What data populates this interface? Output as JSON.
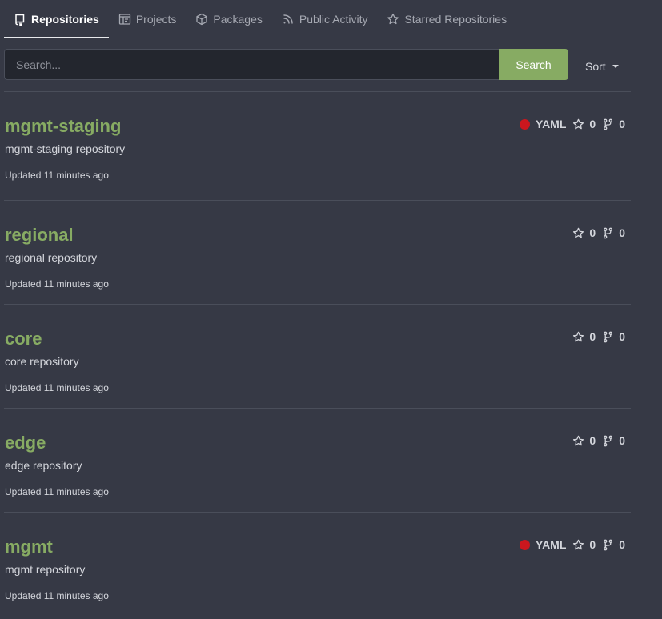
{
  "tabs": [
    {
      "label": "Repositories",
      "icon": "repo-icon",
      "active": true
    },
    {
      "label": "Projects",
      "icon": "project-icon",
      "active": false
    },
    {
      "label": "Packages",
      "icon": "package-icon",
      "active": false
    },
    {
      "label": "Public Activity",
      "icon": "rss-icon",
      "active": false
    },
    {
      "label": "Starred Repositories",
      "icon": "star-icon",
      "active": false
    }
  ],
  "search": {
    "placeholder": "Search...",
    "value": "",
    "button_label": "Search"
  },
  "sort": {
    "label": "Sort"
  },
  "colors": {
    "accent": "#87ab63",
    "yaml_lang": "#cb171e",
    "background": "#363945"
  },
  "repos": [
    {
      "name": "mgmt-staging",
      "description": "mgmt-staging repository",
      "updated": "Updated 11 minutes ago",
      "language": "YAML",
      "stars": "0",
      "forks": "0"
    },
    {
      "name": "regional",
      "description": "regional repository",
      "updated": "Updated 11 minutes ago",
      "language": "",
      "stars": "0",
      "forks": "0"
    },
    {
      "name": "core",
      "description": "core repository",
      "updated": "Updated 11 minutes ago",
      "language": "",
      "stars": "0",
      "forks": "0"
    },
    {
      "name": "edge",
      "description": "edge repository",
      "updated": "Updated 11 minutes ago",
      "language": "",
      "stars": "0",
      "forks": "0"
    },
    {
      "name": "mgmt",
      "description": "mgmt repository",
      "updated": "Updated 11 minutes ago",
      "language": "YAML",
      "stars": "0",
      "forks": "0"
    }
  ]
}
